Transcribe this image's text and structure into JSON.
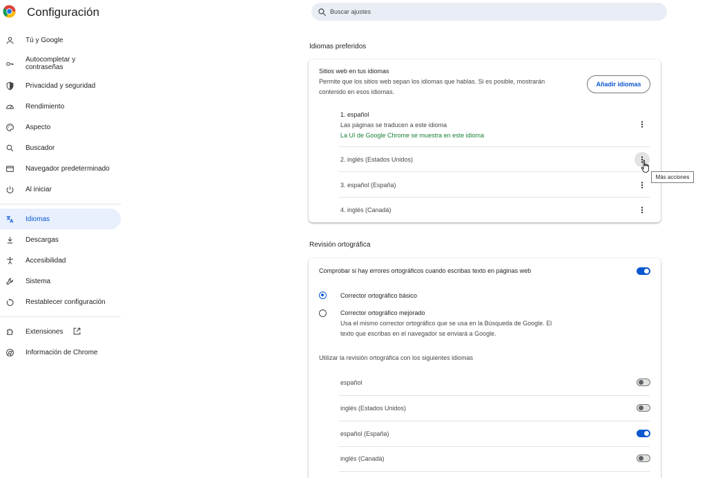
{
  "header": {
    "title": "Configuración"
  },
  "search": {
    "placeholder": "Buscar ajustes"
  },
  "sidebar": {
    "items": [
      {
        "label": "Tú y Google",
        "icon": "person-icon"
      },
      {
        "label": "Autocompletar y contraseñas",
        "icon": "key-icon"
      },
      {
        "label": "Privacidad y seguridad",
        "icon": "shield-icon"
      },
      {
        "label": "Rendimiento",
        "icon": "speedometer-icon"
      },
      {
        "label": "Aspecto",
        "icon": "palette-icon"
      },
      {
        "label": "Buscador",
        "icon": "search-icon"
      },
      {
        "label": "Navegador predeterminado",
        "icon": "browser-icon"
      },
      {
        "label": "Al iniciar",
        "icon": "power-icon"
      },
      {
        "label": "Idiomas",
        "icon": "translate-icon",
        "active": true
      },
      {
        "label": "Descargas",
        "icon": "download-icon"
      },
      {
        "label": "Accesibilidad",
        "icon": "accessibility-icon"
      },
      {
        "label": "Sistema",
        "icon": "wrench-icon"
      },
      {
        "label": "Restablecer configuración",
        "icon": "restore-icon"
      },
      {
        "label": "Extensiones",
        "icon": "puzzle-icon"
      },
      {
        "label": "Información de Chrome",
        "icon": "chrome-icon"
      }
    ]
  },
  "languages": {
    "section_title": "Idiomas preferidos",
    "card_title": "Sitios web en tus idiomas",
    "card_desc_1": "Permite que los sitios web sepan los idiomas que hablas. Si es posible, mostrarán",
    "card_desc_2": "contenido en esos idiomas.",
    "add_button": "Añadir idiomas",
    "list": [
      {
        "label": "1. español",
        "note": "Las páginas se traducen a este idioma",
        "note2": "La UI de Google Chrome se muestra en este idioma"
      },
      {
        "label": "2. inglés (Estados Unidos)"
      },
      {
        "label": "3. español (España)"
      },
      {
        "label": "4. inglés (Canadá)"
      }
    ],
    "tooltip": "Más acciones"
  },
  "spellcheck": {
    "section_title": "Revisión ortográfica",
    "main_label": "Comprobar si hay errores ortográficos cuando escribas texto en páginas web",
    "main_enabled": true,
    "basic_label": "Corrector ortográfico básico",
    "basic_selected": true,
    "enhanced_label": "Corrector ortográfico mejorado",
    "enhanced_desc_1": "Usa el mismo corrector ortográfico que se usa en la Búsqueda de Google. El",
    "enhanced_desc_2": "texto que escribas en el navegador se enviará a Google.",
    "languages_heading": "Utilizar la revisión ortográfica con los siguientes idiomas",
    "languages": [
      {
        "label": "español",
        "enabled": false
      },
      {
        "label": "inglés (Estados Unidos)",
        "enabled": false
      },
      {
        "label": "español (España)",
        "enabled": true
      },
      {
        "label": "inglés (Canadá)",
        "enabled": false
      }
    ]
  },
  "colors": {
    "accent": "#0b57d0",
    "active_nav_bg": "#e8f0fe",
    "green_note": "#188038"
  }
}
